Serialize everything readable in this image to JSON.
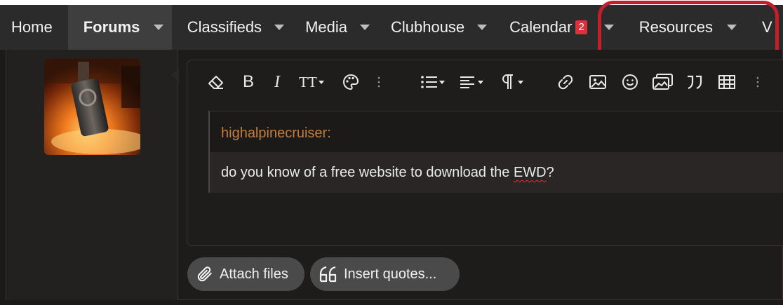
{
  "nav": {
    "items": [
      {
        "label": "Home",
        "has_caret": false,
        "active": false
      },
      {
        "label": "Forums",
        "has_caret": true,
        "active": true
      },
      {
        "label": "Classifieds",
        "has_caret": true,
        "active": false
      },
      {
        "label": "Media",
        "has_caret": true,
        "active": false
      },
      {
        "label": "Clubhouse",
        "has_caret": true,
        "active": false
      },
      {
        "label": "Calendar",
        "has_caret": true,
        "active": false,
        "badge": "2"
      },
      {
        "label": "Resources",
        "has_caret": true,
        "active": false
      },
      {
        "label": "V",
        "has_caret": false,
        "active": false
      }
    ]
  },
  "colors": {
    "nav_bg": "#2c2b2b",
    "active_bg": "#3f3e3e",
    "badge": "#d8323a",
    "highlight_annotation": "#c21f2b",
    "quote_author": "#c47d3b",
    "button_bg": "#4a4a4a"
  },
  "toolbar": {
    "icons": [
      "eraser-icon",
      "bold-icon",
      "italic-icon",
      "text-size-icon",
      "palette-icon",
      "more-vertical-icon",
      "list-icon",
      "align-icon",
      "paragraph-icon",
      "link-icon",
      "image-icon",
      "smiley-icon",
      "media-icon",
      "quote-icon",
      "table-icon",
      "more-vertical-icon"
    ],
    "bold_label": "B",
    "italic_label": "I",
    "text_size_label": "TT"
  },
  "quote": {
    "author": "highalpinecruiser:",
    "text_before": "do you know of a free website to download the ",
    "text_misspelled": "EWD",
    "text_after": "?"
  },
  "actions": {
    "attach_label": "Attach files",
    "insert_quotes_label": "Insert quotes..."
  }
}
